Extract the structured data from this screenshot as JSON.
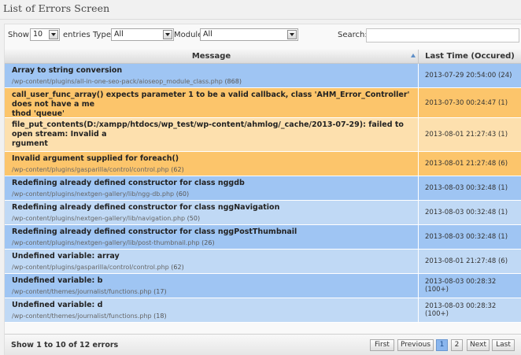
{
  "page": {
    "title": "List of Errors Screen"
  },
  "filters": {
    "show_label": "Show",
    "show_value": "10",
    "entries_label": "entries",
    "type_label": "Type",
    "type_value": "All",
    "module_label": "Module",
    "module_value": "All",
    "search_label": "Search:",
    "search_value": ""
  },
  "table": {
    "headers": {
      "message": "Message",
      "time": "Last Time (Occured)"
    },
    "rows": [
      {
        "title": "Array to string conversion",
        "title2": "",
        "path": "/wp-content/plugins/all-in-one-seo-pack/aioseop_module_class.php",
        "line": "(868)",
        "time": "2013-07-29 20:54:00 (24)",
        "color": "#9fc5f3"
      },
      {
        "title": "call_user_func_array() expects parameter 1 to be a valid callback, class 'AHM_Error_Controller' does not have a me",
        "title2": "thod 'queue'",
        "path": "/wp-content/plugins/wp-bug-tracker/application/Core/router.php",
        "line": "(107)",
        "time": "2013-07-30 00:24:47 (1)",
        "color": "#fcc56b"
      },
      {
        "title": "file_put_contents(D:/xampp/htdocs/wp_test/wp-content/ahmlog/_cache/2013-07-29): failed to open stream: Invalid a",
        "title2": "rgument",
        "path": "/wp-content/plugins/wp-bug-tracker/application/Error/Model/Storage/file.php",
        "line": "(51)",
        "time": "2013-08-01 21:27:43 (1)",
        "color": "#fde0ae"
      },
      {
        "title": "Invalid argument supplied for foreach()",
        "title2": "",
        "path": "/wp-content/plugins/gasparilla/control/control.php",
        "line": "(62)",
        "time": "2013-08-01 21:27:48 (6)",
        "color": "#fcc56b"
      },
      {
        "title": "Redefining already defined constructor for class nggdb",
        "title2": "",
        "path": "/wp-content/plugins/nextgen-gallery/lib/ngg-db.php",
        "line": "(60)",
        "time": "2013-08-03 00:32:48 (1)",
        "color": "#9fc5f3"
      },
      {
        "title": "Redefining already defined constructor for class nggNavigation",
        "title2": "",
        "path": "/wp-content/plugins/nextgen-gallery/lib/navigation.php",
        "line": "(50)",
        "time": "2013-08-03 00:32:48 (1)",
        "color": "#c0d9f5"
      },
      {
        "title": "Redefining already defined constructor for class nggPostThumbnail",
        "title2": "",
        "path": "/wp-content/plugins/nextgen-gallery/lib/post-thumbnail.php",
        "line": "(26)",
        "time": "2013-08-03 00:32:48 (1)",
        "color": "#9fc5f3"
      },
      {
        "title": "Undefined variable: array",
        "title2": "",
        "path": "/wp-content/plugins/gasparilla/control/control.php",
        "line": "(62)",
        "time": "2013-08-01 21:27:48 (6)",
        "color": "#c0d9f5"
      },
      {
        "title": "Undefined variable: b",
        "title2": "",
        "path": "/wp-content/themes/journalist/functions.php",
        "line": "(17)",
        "time": "2013-08-03 00:28:32 (100+)",
        "color": "#9fc5f3"
      },
      {
        "title": "Undefined variable: d",
        "title2": "",
        "path": "/wp-content/themes/journalist/functions.php",
        "line": "(18)",
        "time": "2013-08-03 00:28:32 (100+)",
        "color": "#c0d9f5"
      }
    ]
  },
  "footer": {
    "info": "Show 1 to 10 of 12 errors",
    "first": "First",
    "previous": "Previous",
    "page1": "1",
    "page2": "2",
    "next": "Next",
    "last": "Last"
  }
}
